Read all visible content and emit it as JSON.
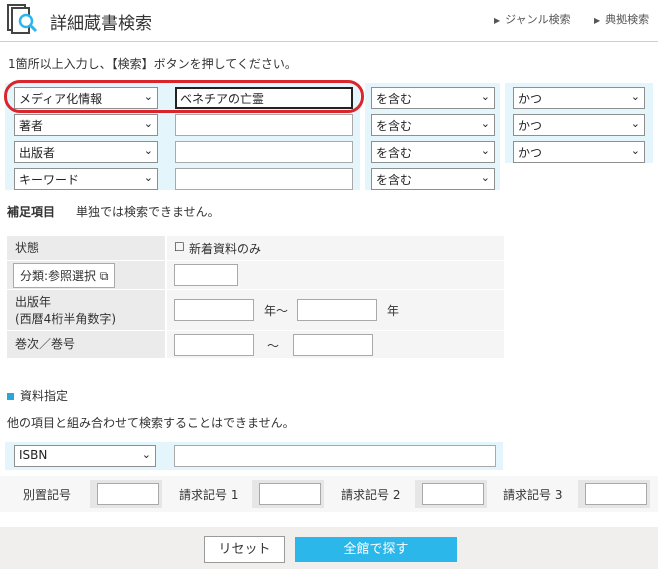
{
  "header": {
    "title": "詳細蔵書検索",
    "links": [
      "ジャンル検索",
      "典拠検索"
    ]
  },
  "instruction": "1箇所以上入力し、【検索】ボタンを押してください。",
  "search_rows": [
    {
      "field": "メディア化情報",
      "value": "ベネチアの亡霊",
      "match": "を含む",
      "op": "かつ"
    },
    {
      "field": "著者",
      "value": "",
      "match": "を含む",
      "op": "かつ"
    },
    {
      "field": "出版者",
      "value": "",
      "match": "を含む",
      "op": "かつ"
    },
    {
      "field": "キーワード",
      "value": "",
      "match": "を含む",
      "op": ""
    }
  ],
  "supplementary": {
    "title": "補足項目",
    "note": "単独では検索できません。",
    "status_label": "状態",
    "new_only_label": "新着資料のみ",
    "category_button": "分類:参照選択",
    "pub_year_label_1": "出版年",
    "pub_year_label_2": "(西暦4桁半角数字)",
    "year_suffix_1": "年～",
    "year_suffix_2": "年",
    "volume_label": "巻次／巻号",
    "volume_sep": "～"
  },
  "material": {
    "title": "資料指定",
    "note": "他の項目と組み合わせて検索することはできません。",
    "id_type": "ISBN",
    "codes": [
      "別置記号",
      "請求記号 1",
      "請求記号 2",
      "請求記号 3"
    ]
  },
  "buttons": {
    "reset": "リセット",
    "search": "全館で探す"
  },
  "colors": {
    "accent": "#2bb7ea",
    "band": "#e4f6fc",
    "highlight": "#d9252c"
  }
}
